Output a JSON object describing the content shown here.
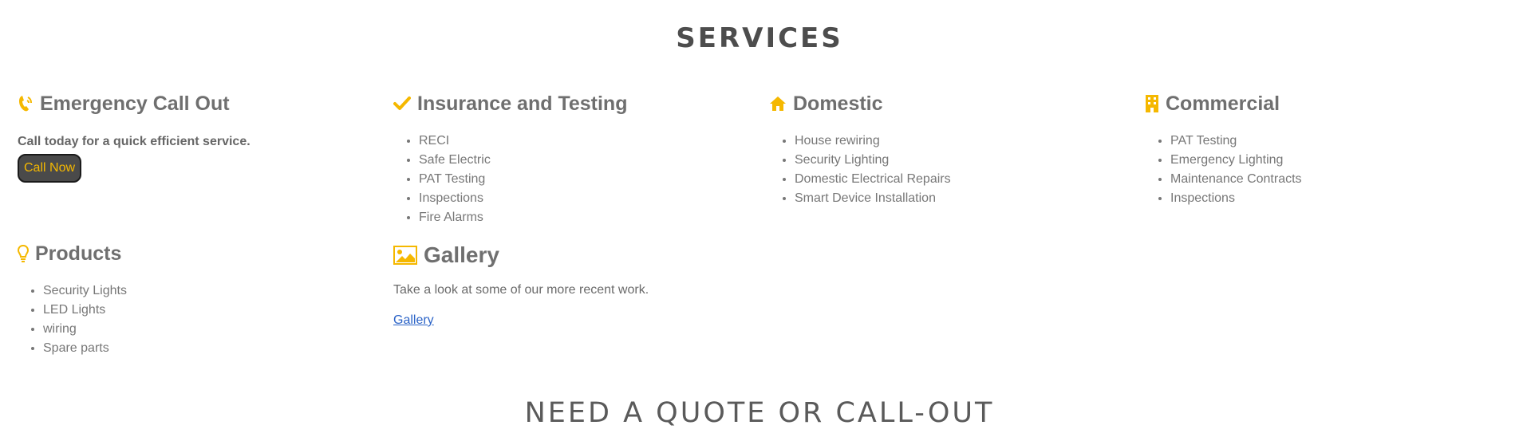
{
  "services": {
    "title": "SERVICES",
    "emergency": {
      "heading": "Emergency Call Out",
      "icon": "phone-icon",
      "text": "Call today for a quick efficient service.",
      "button": "Call Now"
    },
    "insurance": {
      "heading": "Insurance and Testing",
      "icon": "checkmark-icon",
      "items": [
        "RECI",
        "Safe Electric",
        "PAT Testing",
        "Inspections",
        "Fire Alarms"
      ]
    },
    "domestic": {
      "heading": "Domestic",
      "icon": "home-icon",
      "items": [
        "House rewiring",
        "Security Lighting",
        "Domestic Electrical Repairs",
        "Smart Device Installation"
      ]
    },
    "commercial": {
      "heading": "Commercial",
      "icon": "building-icon",
      "items": [
        "PAT Testing",
        "Emergency Lighting",
        "Maintenance Contracts",
        "Inspections"
      ]
    },
    "products": {
      "heading": "Products",
      "icon": "lightbulb-icon",
      "items": [
        "Security Lights",
        "LED Lights",
        "wiring",
        "Spare parts"
      ]
    },
    "gallery": {
      "heading": "Gallery",
      "icon": "image-icon",
      "text": "Take a look at some of our more recent work.",
      "link": "Gallery"
    }
  },
  "quote": {
    "heading": "NEED A QUOTE OR CALL-OUT"
  },
  "colors": {
    "accent": "#f5b800",
    "button_bg": "#4a4a4a",
    "link": "#2b63c7"
  }
}
